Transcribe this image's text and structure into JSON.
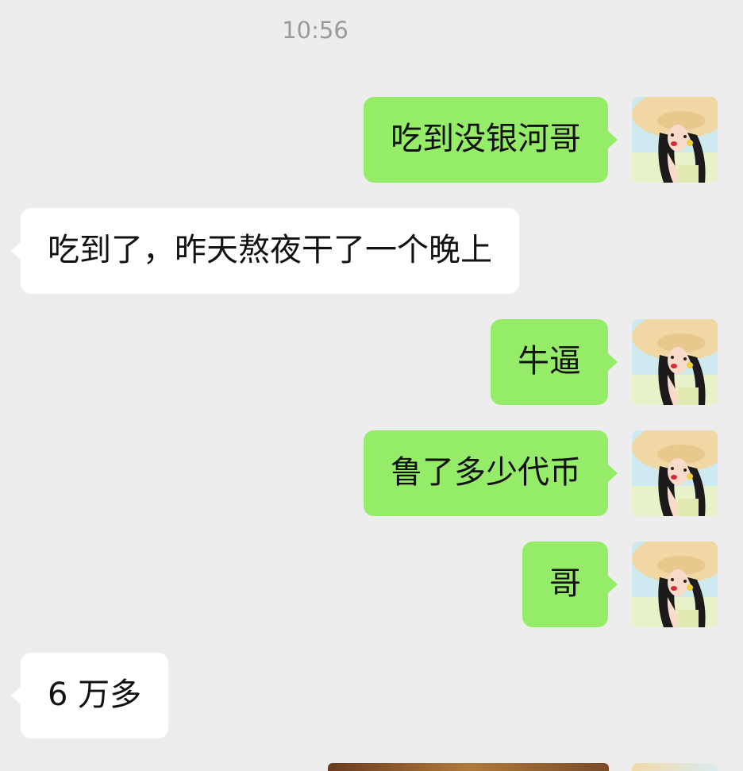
{
  "chat": {
    "timestamp": "10:56",
    "messages": [
      {
        "direction": "sent",
        "text": "吃到没银河哥"
      },
      {
        "direction": "received",
        "text": "吃到了，昨天熬夜干了一个晚上"
      },
      {
        "direction": "sent",
        "text": "牛逼"
      },
      {
        "direction": "sent",
        "text": "鲁了多少代币"
      },
      {
        "direction": "sent",
        "text": "哥"
      },
      {
        "direction": "received",
        "text": "6 万多"
      }
    ]
  },
  "colors": {
    "background": "#ededed",
    "sent_bubble": "#95ec69",
    "received_bubble": "#ffffff",
    "timestamp_text": "#9a9a9a",
    "message_text": "#111111"
  },
  "icons": {
    "avatar": "user-avatar-girl-sunhat"
  }
}
